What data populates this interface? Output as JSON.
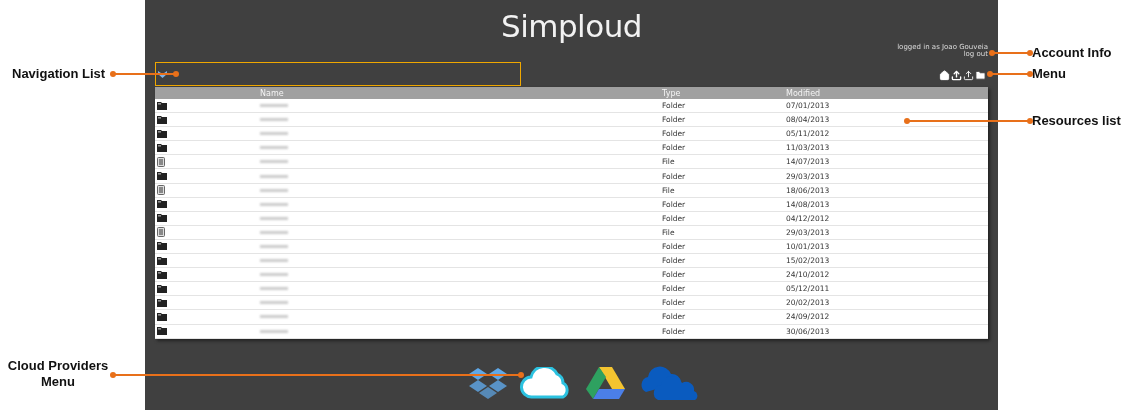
{
  "app": {
    "title": "Simploud"
  },
  "account": {
    "line_1": "logged in as Joao Gouveia",
    "line_2": "log out"
  },
  "table": {
    "columns": [
      "Name",
      "Type",
      "Modified"
    ],
    "rows": [
      {
        "kind": "folder",
        "type": "Folder",
        "modified": "07/01/2013"
      },
      {
        "kind": "folder",
        "type": "Folder",
        "modified": "08/04/2013"
      },
      {
        "kind": "folder",
        "type": "Folder",
        "modified": "05/11/2012"
      },
      {
        "kind": "folder",
        "type": "Folder",
        "modified": "11/03/2013"
      },
      {
        "kind": "file",
        "type": "File",
        "modified": "14/07/2013"
      },
      {
        "kind": "folder",
        "type": "Folder",
        "modified": "29/03/2013"
      },
      {
        "kind": "file",
        "type": "File",
        "modified": "18/06/2013"
      },
      {
        "kind": "folder",
        "type": "Folder",
        "modified": "14/08/2013"
      },
      {
        "kind": "folder",
        "type": "Folder",
        "modified": "04/12/2012"
      },
      {
        "kind": "file",
        "type": "File",
        "modified": "29/03/2013"
      },
      {
        "kind": "folder",
        "type": "Folder",
        "modified": "10/01/2013"
      },
      {
        "kind": "folder",
        "type": "Folder",
        "modified": "15/02/2013"
      },
      {
        "kind": "folder",
        "type": "Folder",
        "modified": "24/10/2012"
      },
      {
        "kind": "folder",
        "type": "Folder",
        "modified": "05/12/2011"
      },
      {
        "kind": "folder",
        "type": "Folder",
        "modified": "20/02/2013"
      },
      {
        "kind": "folder",
        "type": "Folder",
        "modified": "24/09/2012"
      },
      {
        "kind": "folder",
        "type": "Folder",
        "modified": "30/06/2013"
      }
    ]
  },
  "annotations": [
    {
      "label": "Navigation List"
    },
    {
      "label": "Cloud Providers Menu"
    },
    {
      "label": "Account Info"
    },
    {
      "label": "Menu"
    },
    {
      "label": "Resources list"
    }
  ]
}
